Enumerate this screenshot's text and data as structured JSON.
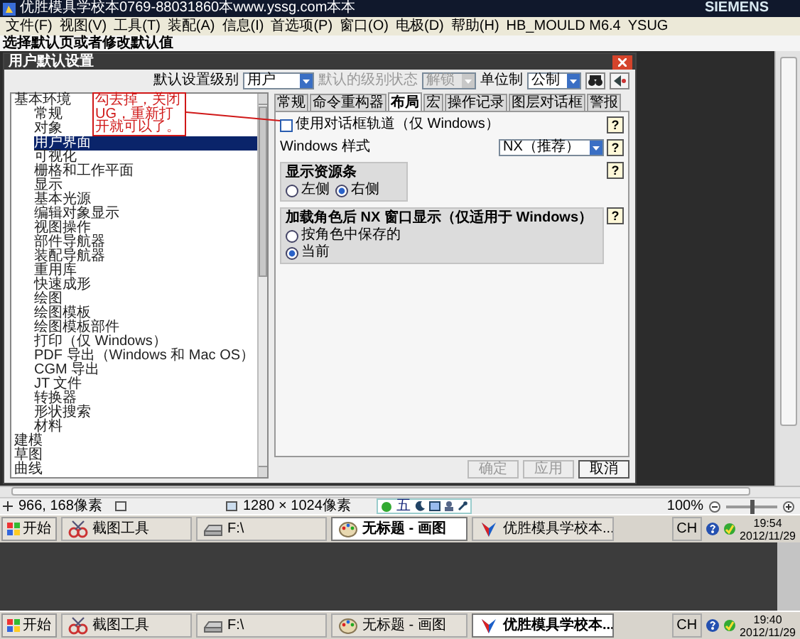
{
  "window": {
    "title": "优胜模具学校本0769-88031860本www.yssg.com本本",
    "brand": "SIEMENS"
  },
  "menu": [
    "文件(F)",
    "视图(V)",
    "工具(T)",
    "装配(A)",
    "信息(I)",
    "首选项(P)",
    "窗口(O)",
    "电极(D)",
    "帮助(H)",
    "HB_MOULD M6.4",
    "YSUG"
  ],
  "cue_line": "选择默认页或者修改默认值",
  "dialog": {
    "title": "用户默认设置",
    "level_label": "默认设置级别",
    "level_value": "用户",
    "state_label": "默认的级别状态",
    "state_value": "解锁",
    "state_disabled": true,
    "units_label": "单位制",
    "units_value": "公制",
    "tree": [
      {
        "label": "基本环境",
        "selected": false,
        "children": [
          {
            "label": "常规",
            "selected": false
          },
          {
            "label": "对象",
            "selected": false
          },
          {
            "label": "用户界面",
            "selected": true
          },
          {
            "label": "可视化",
            "selected": false
          },
          {
            "label": "栅格和工作平面",
            "selected": false
          },
          {
            "label": "显示",
            "selected": false
          },
          {
            "label": "基本光源",
            "selected": false
          },
          {
            "label": "编辑对象显示",
            "selected": false
          },
          {
            "label": "视图操作",
            "selected": false
          },
          {
            "label": "部件导航器",
            "selected": false
          },
          {
            "label": "装配导航器",
            "selected": false
          },
          {
            "label": "重用库",
            "selected": false
          },
          {
            "label": "快速成形",
            "selected": false
          },
          {
            "label": "绘图",
            "selected": false
          },
          {
            "label": "绘图模板",
            "selected": false
          },
          {
            "label": "绘图模板部件",
            "selected": false
          },
          {
            "label": "打印（仅 Windows）",
            "selected": false
          },
          {
            "label": "PDF 导出（Windows 和 Mac OS）",
            "selected": false
          },
          {
            "label": "CGM 导出",
            "selected": false
          },
          {
            "label": "JT 文件",
            "selected": false
          },
          {
            "label": "转换器",
            "selected": false
          },
          {
            "label": "形状搜索",
            "selected": false
          },
          {
            "label": "材料",
            "selected": false
          }
        ]
      },
      {
        "label": "建模",
        "selected": false
      },
      {
        "label": "草图",
        "selected": false
      },
      {
        "label": "曲线",
        "selected": false
      }
    ],
    "tabs": [
      {
        "label": "常规",
        "selected": false
      },
      {
        "label": "命令重构器",
        "selected": false
      },
      {
        "label": "布局",
        "selected": true
      },
      {
        "label": "宏",
        "selected": false
      },
      {
        "label": "操作记录",
        "selected": false
      },
      {
        "label": "图层对话框",
        "selected": false
      },
      {
        "label": "警报",
        "selected": false
      }
    ],
    "options": [
      {
        "kind": "checkbox",
        "label": "使用对话框轨道（仅 Windows）",
        "checked": false,
        "help": "?"
      },
      {
        "kind": "dropdown",
        "label": "Windows 样式",
        "value": "NX（推荐）",
        "help": "?"
      },
      {
        "kind": "radio_row",
        "title": "显示资源条",
        "help": "?",
        "choices": [
          {
            "label": "左侧",
            "selected": false
          },
          {
            "label": "右侧",
            "selected": true
          }
        ]
      },
      {
        "kind": "radio_list",
        "title": "加载角色后 NX 窗口显示（仅适用于 Windows）",
        "help": "?",
        "choices": [
          {
            "label": "按角色中保存的",
            "selected": false
          },
          {
            "label": "当前",
            "selected": true
          }
        ]
      }
    ],
    "buttons": [
      {
        "label": "确定",
        "disabled": true
      },
      {
        "label": "应用",
        "disabled": true
      },
      {
        "label": "取消",
        "disabled": false
      }
    ],
    "annotation": "勾去掉，关闭UG，重新打开就可以了。"
  },
  "paint_status": {
    "cursor": "966, 168像素",
    "canvas_size": "1280 × 1024像素",
    "ime": "五",
    "zoom": "100%",
    "zoom_slider": {
      "level": 0.5
    }
  },
  "taskbars": [
    {
      "start": "开始",
      "items": [
        {
          "label": "截图工具",
          "selected": false
        },
        {
          "label": "F:\\",
          "selected": false
        },
        {
          "label": "无标题 - 画图",
          "selected": true
        },
        {
          "label": "优胜模具学校本...",
          "selected": false
        }
      ],
      "lang": "CH",
      "time": "19:54",
      "date": "2012/11/29"
    },
    {
      "start": "开始",
      "items": [
        {
          "label": "截图工具",
          "selected": false
        },
        {
          "label": "F:\\",
          "selected": false
        },
        {
          "label": "无标题 - 画图",
          "selected": false
        },
        {
          "label": "优胜模具学校本...",
          "selected": true
        }
      ],
      "lang": "CH",
      "time": "19:40",
      "date": "2012/11/29"
    }
  ]
}
